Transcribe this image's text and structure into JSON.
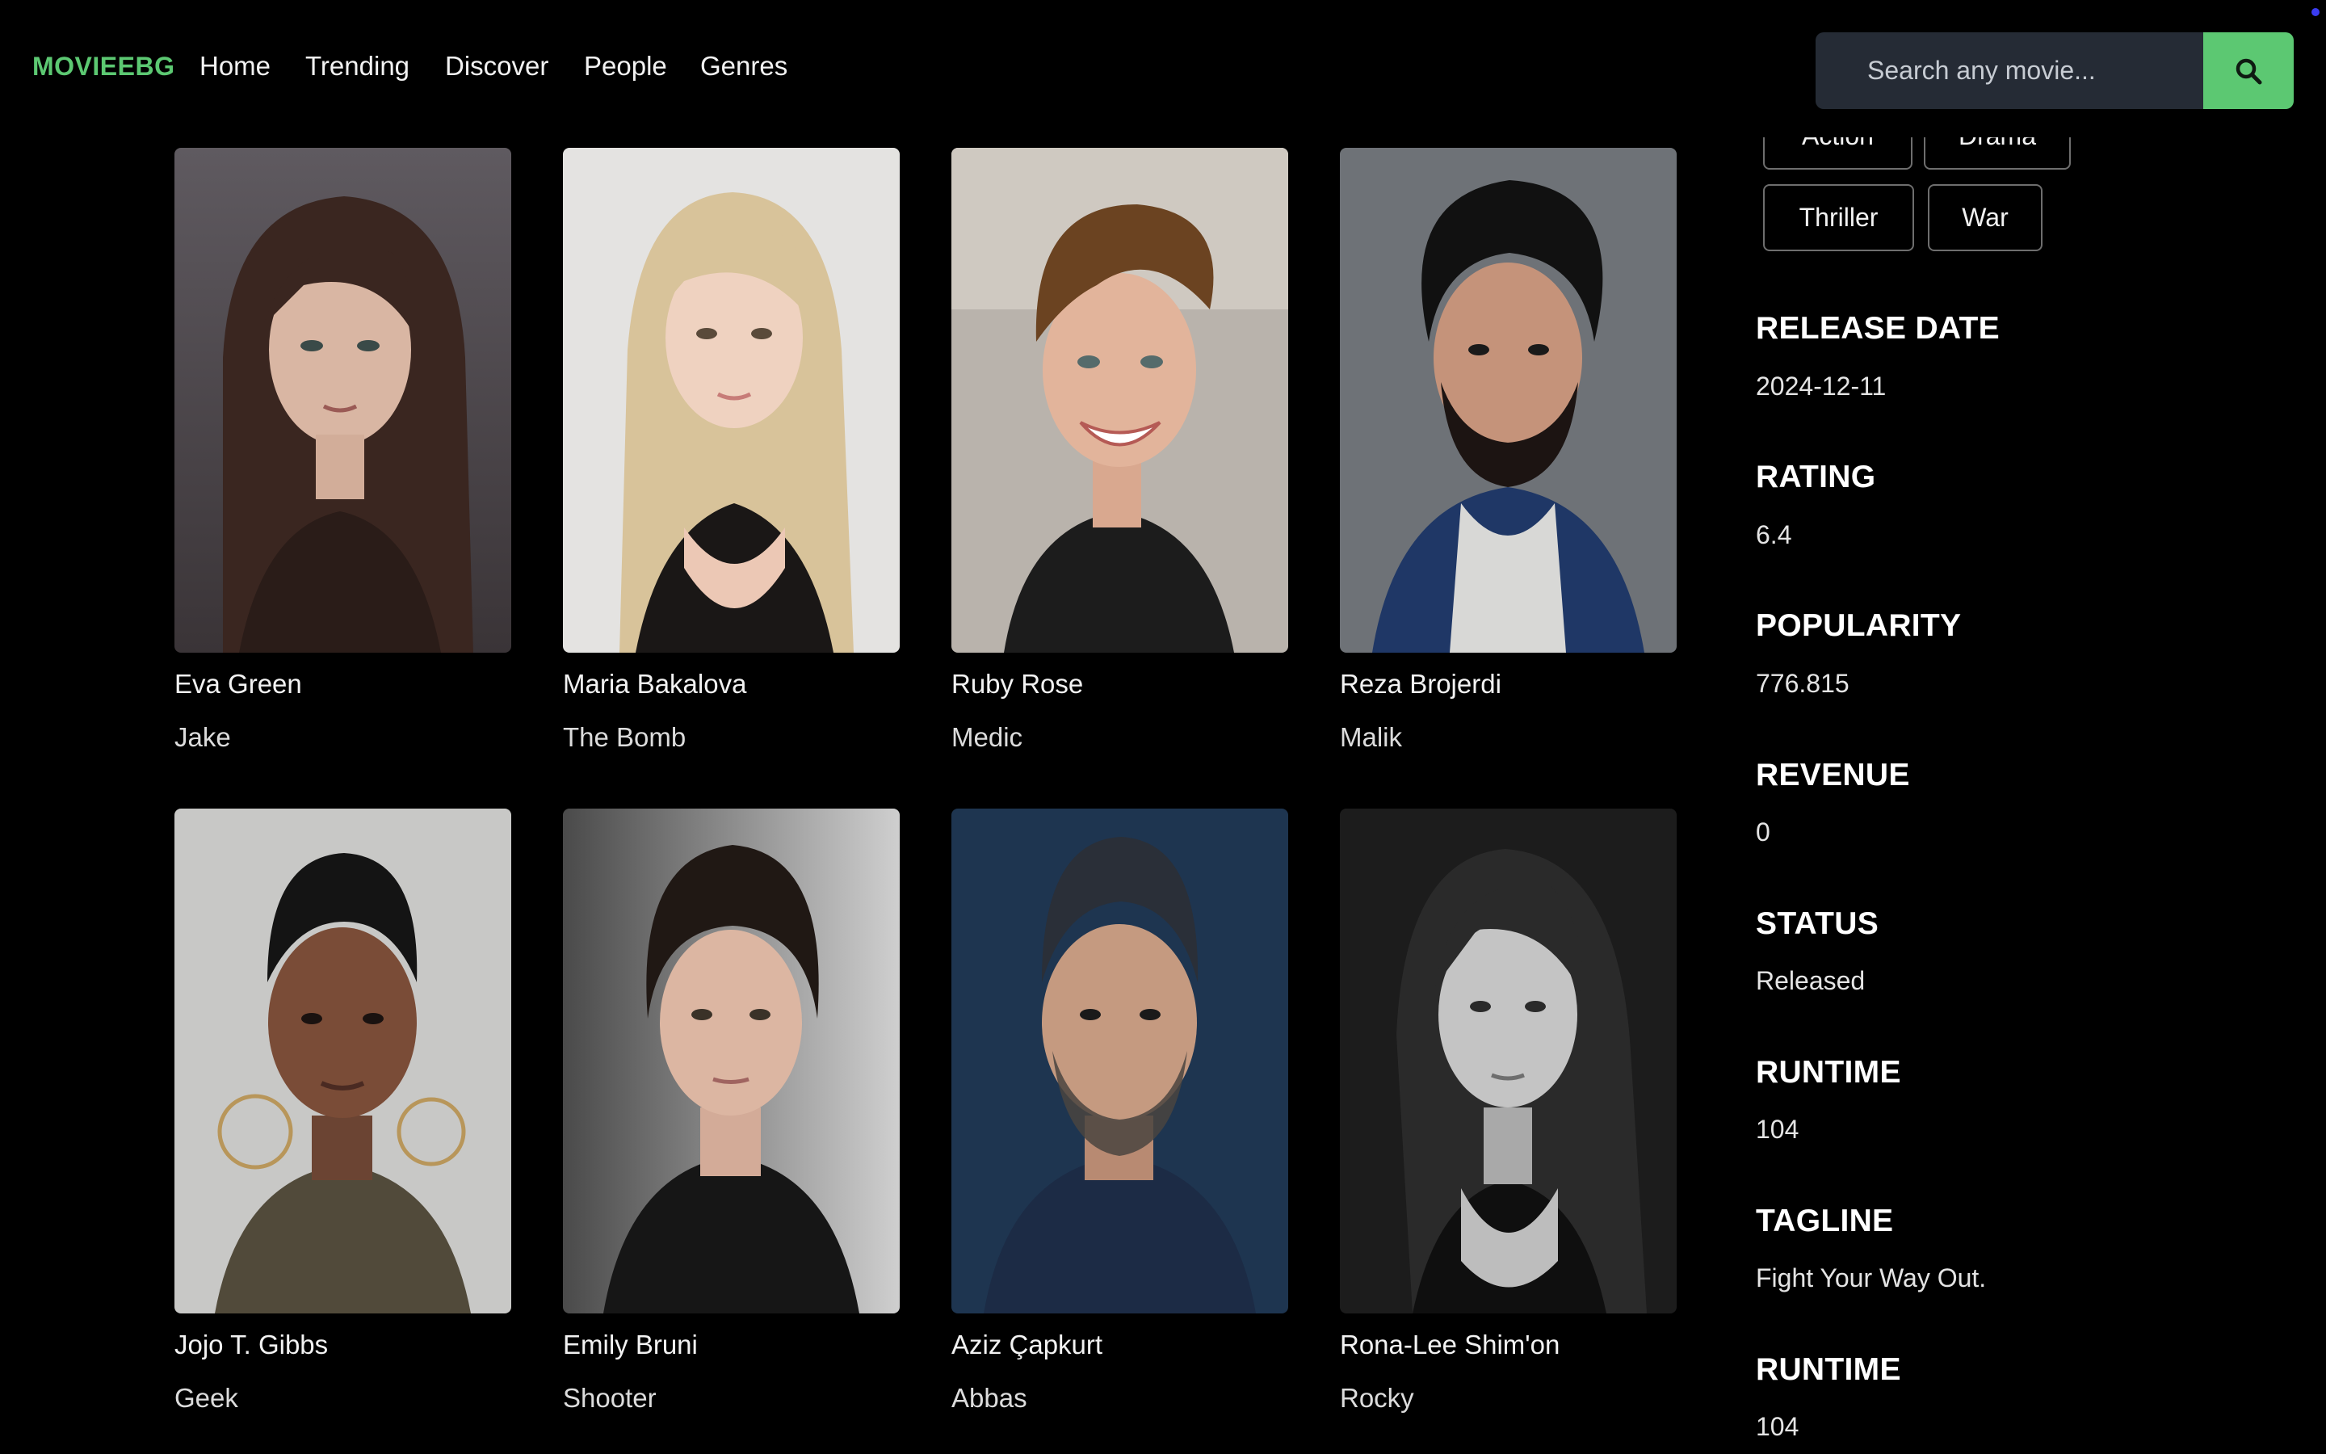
{
  "navbar": {
    "logo": "MOVIEEBG",
    "links": [
      "Home",
      "Trending",
      "Discover",
      "People",
      "Genres"
    ],
    "search_placeholder": "Search any movie..."
  },
  "cast": [
    {
      "name": "Eva Green",
      "role": "Jake"
    },
    {
      "name": "Maria Bakalova",
      "role": "The Bomb"
    },
    {
      "name": "Ruby Rose",
      "role": "Medic"
    },
    {
      "name": "Reza Brojerdi",
      "role": "Malik"
    },
    {
      "name": "Jojo T. Gibbs",
      "role": "Geek"
    },
    {
      "name": "Emily Bruni",
      "role": "Shooter"
    },
    {
      "name": "Aziz Çapkurt",
      "role": "Abbas"
    },
    {
      "name": "Rona-Lee Shim'on",
      "role": "Rocky"
    }
  ],
  "genres": [
    "Action",
    "Drama",
    "Thriller",
    "War"
  ],
  "details": [
    {
      "label": "RELEASE DATE",
      "value": "2024-12-11"
    },
    {
      "label": "RATING",
      "value": "6.4"
    },
    {
      "label": "POPULARITY",
      "value": "776.815"
    },
    {
      "label": "REVENUE",
      "value": "0"
    },
    {
      "label": "STATUS",
      "value": "Released"
    },
    {
      "label": "RUNTIME",
      "value": "104"
    },
    {
      "label": "TAGLINE",
      "value": "Fight Your Way Out."
    },
    {
      "label": "RUNTIME",
      "value": "104"
    }
  ],
  "colors": {
    "accent": "#5cc872",
    "search_bg": "#252b35",
    "page_bg": "#000000"
  }
}
